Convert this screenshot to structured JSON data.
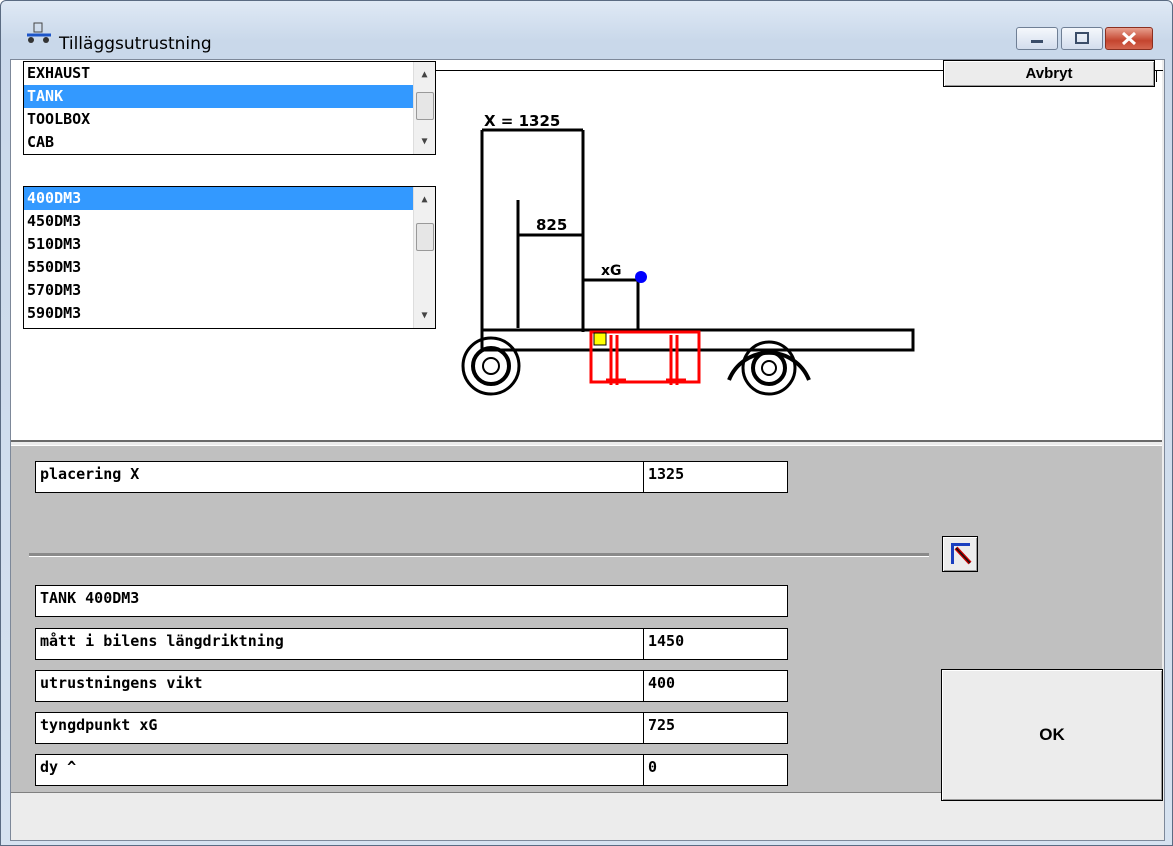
{
  "window": {
    "title": "Tilläggsutrustning",
    "icon": "truck-app-icon",
    "controls": [
      "minimize-icon",
      "maximize-icon",
      "close-icon"
    ]
  },
  "equipment_list": {
    "items": [
      "EXHAUST",
      "TANK",
      "TOOLBOX",
      "CAB"
    ],
    "selected": "TANK"
  },
  "size_list": {
    "items": [
      "400DM3",
      "450DM3",
      "510DM3",
      "550DM3",
      "570DM3",
      "590DM3"
    ],
    "selected": "400DM3"
  },
  "cancel_button": "Avbryt",
  "drawing": {
    "x_label": "X = 1325",
    "dim_label": "825",
    "xg_label": "xG"
  },
  "fields": {
    "placering_label": "placering  X",
    "placering_value": "1325",
    "equipment_name": "TANK  400DM3",
    "length_label": "mått i bilens längdriktning",
    "length_value": "1450",
    "weight_label": "utrustningens vikt",
    "weight_value": "400",
    "cog_label": "tyngdpunkt  xG",
    "cog_value": "725",
    "dy_label": "dy    ^",
    "dy_value": "0"
  },
  "tool_button_icon": "measure-tool-icon",
  "ok_button": "OK",
  "colors": {
    "selection": "#3399ff",
    "equipment": "#ff0000",
    "cog_marker": "#0000ff",
    "marker": "#ffff00"
  }
}
